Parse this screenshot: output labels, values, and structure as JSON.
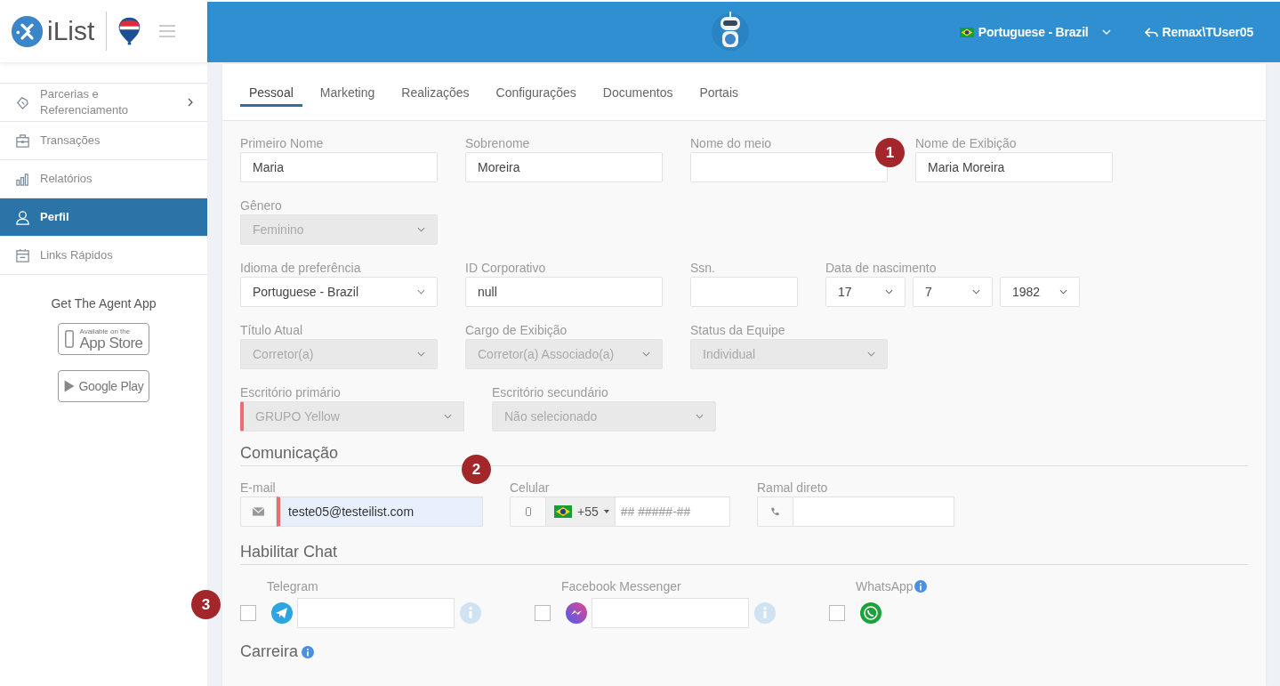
{
  "brand": {
    "name": "iList"
  },
  "sidebar": {
    "items": [
      {
        "label": "Parcerias e Referenciamento",
        "expandable": true,
        "selected": false
      },
      {
        "label": "Transações",
        "expandable": false,
        "selected": false
      },
      {
        "label": "Relatórios",
        "expandable": false,
        "selected": false
      },
      {
        "label": "Perfil",
        "expandable": false,
        "selected": true
      },
      {
        "label": "Links Rápidos",
        "expandable": false,
        "selected": false
      }
    ],
    "app_promo": {
      "title": "Get The Agent App",
      "badges": [
        {
          "kind": "appstore",
          "small": "Available on the",
          "big": "App Store"
        },
        {
          "kind": "googleplay",
          "big": "Google Play"
        }
      ]
    }
  },
  "header": {
    "language": "Portuguese - Brazil",
    "user": "Remax\\TUser05"
  },
  "tabs": [
    {
      "label": "Pessoal",
      "selected": true
    },
    {
      "label": "Marketing",
      "selected": false
    },
    {
      "label": "Realizações",
      "selected": false
    },
    {
      "label": "Configurações",
      "selected": false
    },
    {
      "label": "Documentos",
      "selected": false
    },
    {
      "label": "Portais",
      "selected": false
    }
  ],
  "form": {
    "rows": [
      {
        "fields": [
          {
            "label": "Primeiro Nome",
            "kind": "text",
            "value": "Maria",
            "disabled": false,
            "required": false
          },
          {
            "label": "Sobrenome",
            "kind": "text",
            "value": "Moreira",
            "disabled": false,
            "required": false
          },
          {
            "label": "Nome do meio",
            "kind": "text",
            "disabled": false,
            "required": false
          },
          {
            "label": "Nome de Exibição",
            "kind": "text",
            "value": "Maria Moreira",
            "disabled": false,
            "required": false,
            "marker": "1"
          }
        ]
      },
      {
        "fields": [
          {
            "label": "Gênero",
            "kind": "select",
            "value": "Feminino",
            "disabled": true,
            "required": false
          }
        ]
      },
      {
        "fields": [
          {
            "label": "Idioma de preferência",
            "kind": "select",
            "value": "Portuguese - Brazil",
            "disabled": false,
            "required": false
          },
          {
            "label": "ID Corporativo",
            "kind": "text",
            "value": "null",
            "disabled": false,
            "required": false
          },
          {
            "label": "Ssn.",
            "kind": "text",
            "disabled": false,
            "required": false
          },
          {
            "label": "Data de nascimento",
            "kind": "date",
            "parts": [
              "17",
              "7",
              "1982"
            ]
          }
        ]
      },
      {
        "fields": [
          {
            "label": "Título Atual",
            "kind": "select",
            "value": "Corretor(a)",
            "disabled": true,
            "required": false
          },
          {
            "label": "Cargo de Exibição",
            "kind": "select",
            "value": "Corretor(a) Associado(a)",
            "disabled": true,
            "required": false
          },
          {
            "label": "Status da Equipe",
            "kind": "select",
            "value": "Individual",
            "disabled": true,
            "required": false
          }
        ]
      },
      {
        "fields": [
          {
            "label": "Escritório primário",
            "kind": "select",
            "value": "GRUPO Yellow",
            "disabled": true,
            "required": true
          },
          {
            "label": "Escritório secundário",
            "kind": "select",
            "value": "Não selecionado",
            "disabled": true,
            "required": false
          }
        ]
      }
    ]
  },
  "communication": {
    "title": "Comunicação",
    "fields": [
      {
        "label": "E-mail",
        "kind": "email",
        "value": "teste05@testeilist.com",
        "required": true,
        "autofilled": true,
        "marker": "2"
      },
      {
        "label": "Celular",
        "kind": "phone",
        "country_code": "+55",
        "placeholder": "## #####-##",
        "required": false,
        "autofilled": false
      },
      {
        "label": "Ramal direto",
        "kind": "extension",
        "required": false,
        "autofilled": false
      }
    ]
  },
  "chat": {
    "title": "Habilitar Chat",
    "items": [
      {
        "label": "Telegram",
        "kind": "with_input",
        "checked": false,
        "marker": "3"
      },
      {
        "label": "Facebook Messenger",
        "kind": "with_input",
        "checked": false
      },
      {
        "label": "WhatsApp",
        "kind": "icon_only",
        "checked": false
      }
    ]
  },
  "career": {
    "title": "Carreira"
  }
}
